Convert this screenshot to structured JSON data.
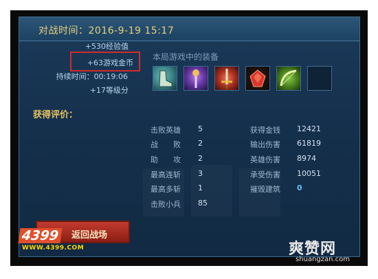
{
  "header": {
    "title": "对战时间：2016-9-19  15:17"
  },
  "rewards": {
    "exp": "+530经验值",
    "gold": "+63游戏金币",
    "duration": "持续时间：00:19:06",
    "level": "+17等级分"
  },
  "equipment": {
    "label": "本局游戏中的装备",
    "items": [
      {
        "icon": "boots-icon",
        "color": "#3c8a8c"
      },
      {
        "icon": "purple-staff-icon",
        "color": "#6a3aa8"
      },
      {
        "icon": "golden-sword-icon",
        "color": "#b23324"
      },
      {
        "icon": "red-gem-icon",
        "color": "#b8281e"
      },
      {
        "icon": "green-bow-icon",
        "color": "#4f8a1f"
      },
      {
        "icon": "empty-slot",
        "color": "#0f2236"
      }
    ]
  },
  "evaluation": {
    "heading": "获得评价：",
    "left": [
      {
        "label": "击败英雄",
        "value": "5"
      },
      {
        "label": "战　　败",
        "value": "2"
      },
      {
        "label": "助　　攻",
        "value": "2"
      },
      {
        "label": "最高连斩",
        "value": "3"
      },
      {
        "label": "最高多斩",
        "value": "1"
      },
      {
        "label": "击败小兵",
        "value": "85"
      }
    ],
    "right": [
      {
        "label": "获得金钱",
        "value": "12421"
      },
      {
        "label": "输出伤害",
        "value": "61819"
      },
      {
        "label": "英雄伤害",
        "value": "8974"
      },
      {
        "label": "承受伤害",
        "value": "10051"
      },
      {
        "label": "摧毁建筑",
        "value": "0"
      }
    ]
  },
  "back_button": {
    "label": "返回战场"
  },
  "watermarks": {
    "logo": "4399",
    "url": "WWW.4399.COM",
    "site": "爽赞网",
    "site_url": "shuangzan.com"
  }
}
